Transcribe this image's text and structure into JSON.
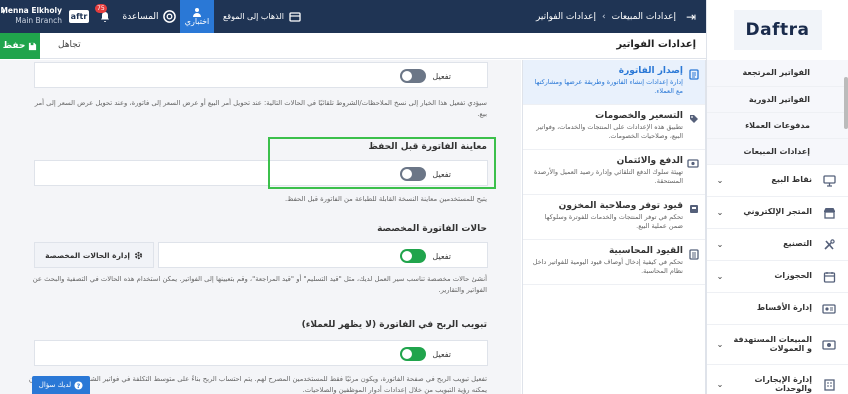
{
  "brand": {
    "logo_text": "Daftra",
    "mini_logo": "aftr"
  },
  "topbar": {
    "user_name": "Menna Elkholy",
    "user_branch": "Main Branch",
    "notifications_count": "75",
    "help_label": "المساعدة",
    "test_mode_label": "اختباري",
    "goto_site_label": "الذهاب إلى الموقع",
    "breadcrumb": [
      "إعدادات المبيعات",
      "إعدادات الفواتير"
    ]
  },
  "pagehead": {
    "save_label": "حفظ",
    "ignore_label": "تجاهل",
    "title": "إعدادات الفواتير"
  },
  "sidebar": {
    "submenu": [
      "الفواتير المرتجعة",
      "الفواتير الدورية",
      "مدفوعات العملاء",
      "إعدادات المبيعات"
    ],
    "items": [
      {
        "label": "نقاط البيع",
        "icon": "pos-icon"
      },
      {
        "label": "المتجر الإلكتروني",
        "icon": "store-icon"
      },
      {
        "label": "التصنيع",
        "icon": "tools-icon"
      },
      {
        "label": "الحجوزات",
        "icon": "calendar-icon"
      },
      {
        "label": "إدارة الأقساط",
        "icon": "installments-icon"
      },
      {
        "label": "المبيعات المستهدفة و العمولات",
        "icon": "target-icon"
      },
      {
        "label": "إدارة الإيجارات والوحدات",
        "icon": "building-icon"
      }
    ]
  },
  "settings_nav": [
    {
      "title": "إصدار الفاتورة",
      "desc": "إدارة إعدادات إنشاء الفاتورة وطريقة عرضها ومشاركتها مع العملاء.",
      "active": true
    },
    {
      "title": "التسعير والخصومات",
      "desc": "تطبيق هذه الإعدادات على المنتجات والخدمات، وفواتير البيع، وصلاحيات الخصومات."
    },
    {
      "title": "الدفع والائتمان",
      "desc": "تهيئة سلوك الدفع التلقائي وإدارة رصيد العميل والأرصدة المستحقة."
    },
    {
      "title": "قيود توفر وصلاحية المخزون",
      "desc": "تحكم في توفر المنتجات والخدمات للفوترة وسلوكها ضمن عملية البيع."
    },
    {
      "title": "القيود المحاسبية",
      "desc": "تحكم في كيفية إدخال أوصاف قيود اليومية للفواتير داخل نظام المحاسبة."
    }
  ],
  "main": {
    "toggle_label": "تفعيل",
    "copy_help": "سيؤدي تفعيل هذا الخيار إلى نسخ الملاحظات/الشروط تلقائيًا في الحالات التالية: عند تحويل أمر البيع أو عرض السعر إلى فاتورة، وعند تحويل عرض السعر إلى أمر بيع.",
    "preview_title": "معاينة الفاتورة قبل الحفظ",
    "preview_help": "يتيح للمستخدمين معاينة النسخة القابلة للطباعة من الفاتورة قبل الحفظ.",
    "custom_title": "حالات الفاتورة المخصصة",
    "manage_btn": "إدارة الحالات المخصصة",
    "custom_help": "أنشئ حالات مخصصة تناسب سير العمل لديك، مثل \"قيد التسليم\" أو \"قيد المراجعة\"، وقم بتعيينها إلى الفواتير. يمكن استخدام هذه الحالات في التصفية والبحث عن الفواتير والتقارير.",
    "profit_title": "تبويب الربح في الفاتورة (لا يظهر للعملاء)",
    "profit_help": "تفعيل تبويب الربح في صفحة الفاتورة، ويكون مرئيًا فقط للمستخدمين المصرح لهم. يتم احتساب الربح بناءً على متوسط التكلفة في فواتير الشراء. يمكن التحكم بمن يمكنه رؤية التبويب من خلال إعدادات أدوار الموظفين والصلاحيات.",
    "ask_label": "لديك سؤال"
  }
}
